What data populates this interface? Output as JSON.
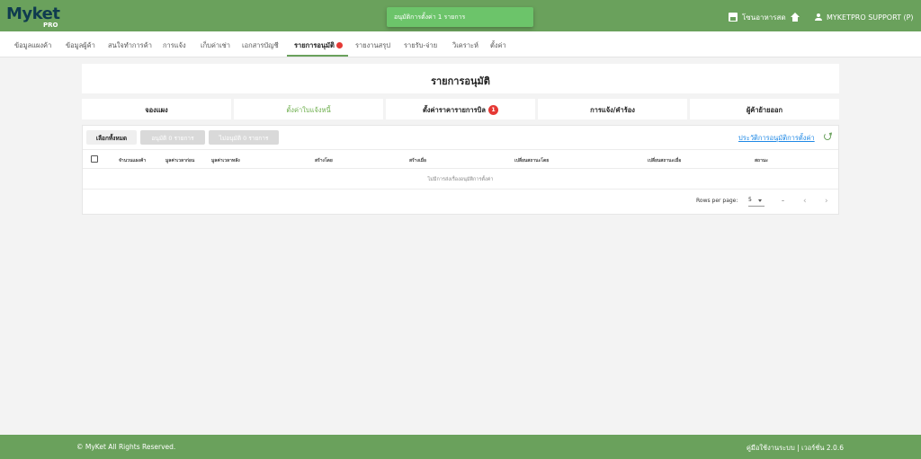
{
  "app": {
    "brand": "Myket",
    "brand_sub": "PRO"
  },
  "toast": {
    "message": "อนุมัติการตั้งค่า 1 รายการ"
  },
  "topbar": {
    "store_label": "โซนอาหารสด",
    "user_label": "MYKETPRO SUPPORT (P)"
  },
  "nav": {
    "items": [
      {
        "label": "ข้อมูลแผงค้า"
      },
      {
        "label": "ข้อมูลผู้ค้า"
      },
      {
        "label": "สนใจทำการค้า"
      },
      {
        "label": "การแจ้ง"
      },
      {
        "label": "เก็บค่าเช่า"
      },
      {
        "label": "เอกสารบัญชี"
      },
      {
        "label": "รายการอนุมัติ"
      },
      {
        "label": "รายงานสรุป"
      },
      {
        "label": "รายรับ-จ่าย"
      },
      {
        "label": "วิเคราะห์"
      },
      {
        "label": "ตั้งค่า"
      }
    ],
    "active_index": 6
  },
  "page": {
    "title": "รายการอนุมัติ"
  },
  "tabs": [
    {
      "label": "จองแผง"
    },
    {
      "label": "ตั้งค่าใบแจ้งหนี้"
    },
    {
      "label": "ตั้งค่าราคารายการบิล",
      "badge": "1"
    },
    {
      "label": "การแจ้ง/คำร้อง"
    },
    {
      "label": "ผู้ค้าย้ายออก"
    }
  ],
  "actions": {
    "select_all": "เลือกทั้งหมด",
    "approve": "อนุมัติ 0 รายการ",
    "reject": "ไม่อนุมัติ 0 รายการ",
    "history_link": "ประวัติการอนุมัติการตั้งค่า"
  },
  "table": {
    "columns": [
      "จำนวนแผงค้า",
      "มูลค่าเวลาก่อน",
      "มูลค่าเวลาหลัง",
      "สร้างโดย",
      "สร้างเมื่อ",
      "เปลี่ยนสถานะโดย",
      "เปลี่ยนสถานะเมื่อ",
      "สถานะ"
    ],
    "empty_message": "ไม่มีการส่งเรื่องอนุมัติการตั้งค่า"
  },
  "pagination": {
    "rows_per_page_label": "Rows per page:",
    "rows_per_page": "5",
    "range": "–"
  },
  "footer": {
    "copyright": "© MyKet All Rights Reserved.",
    "right": "คู่มือใช้งานระบบ | เวอร์ชั่น 2.0.6"
  },
  "colors": {
    "primary": "#6aa15c",
    "badge": "#e53935",
    "link": "#1e88e5"
  }
}
